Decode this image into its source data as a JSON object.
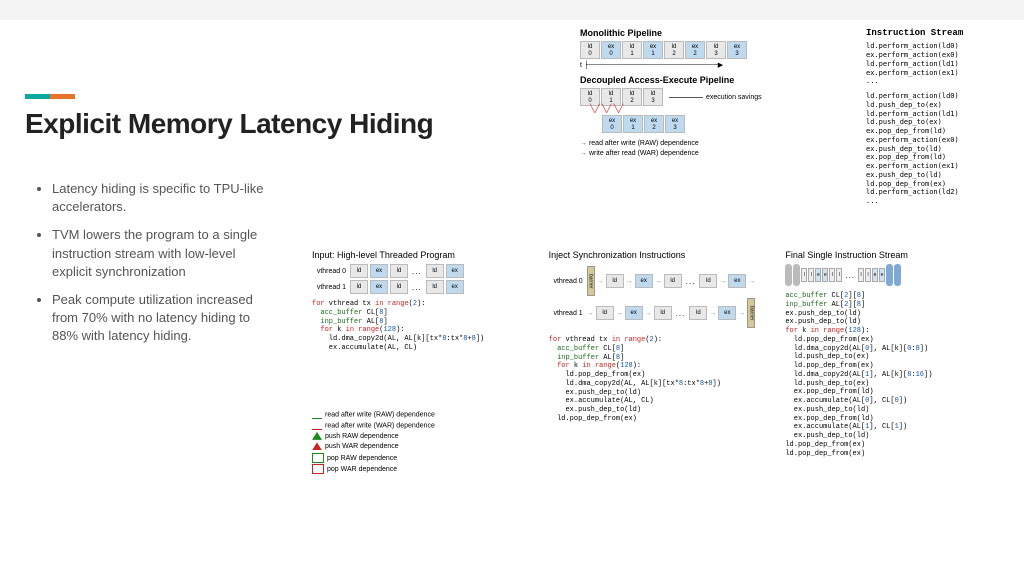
{
  "title": "Explicit Memory Latency Hiding",
  "bullets": [
    "Latency hiding is specific to TPU-like accelerators.",
    "TVM lowers the program to a single instruction stream with low-level explicit synchronization",
    "Peak compute utilization increased from 70% with no latency hiding to 88% with latency hiding."
  ],
  "top": {
    "mono_label": "Monolithic Pipeline",
    "dae_label": "Decoupled Access-Execute Pipeline",
    "instr_label": "Instruction Stream",
    "exec_savings": "execution savings",
    "t_axis": "t",
    "raw_dep": "read after write  (RAW) dependence",
    "war_dep": "write after read  (WAR) dependence",
    "mono_stages": [
      {
        "k": "ld",
        "n": "0"
      },
      {
        "k": "ex",
        "n": "0"
      },
      {
        "k": "ld",
        "n": "1"
      },
      {
        "k": "ex",
        "n": "1"
      },
      {
        "k": "ld",
        "n": "2"
      },
      {
        "k": "ex",
        "n": "2"
      },
      {
        "k": "ld",
        "n": "3"
      },
      {
        "k": "ex",
        "n": "3"
      }
    ],
    "dae_ld": [
      {
        "k": "ld",
        "n": "0"
      },
      {
        "k": "ld",
        "n": "1"
      },
      {
        "k": "ld",
        "n": "2"
      },
      {
        "k": "ld",
        "n": "3"
      }
    ],
    "dae_ex": [
      {
        "k": "ex",
        "n": "0"
      },
      {
        "k": "ex",
        "n": "1"
      },
      {
        "k": "ex",
        "n": "2"
      },
      {
        "k": "ex",
        "n": "3"
      }
    ],
    "instr1": "ld.perform_action(ld0)\nex.perform_action(ex0)\nld.perform_action(ld1)\nex.perform_action(ex1)\n...",
    "instr2": "ld.perform_action(ld0)\nld.push_dep_to(ex)\nld.perform_action(ld1)\nld.push_dep_to(ex)\nex.pop_dep_from(ld)\nex.perform_action(ex0)\nex.push_dep_to(ld)\nex.pop_dep_from(ld)\nex.perform_action(ex1)\nex.push_dep_to(ld)\nld.pop_dep_from(ex)\nld.perform_action(ld2)\n..."
  },
  "panels": {
    "p1_title": "Input: High-level Threaded Program",
    "p2_title": "Inject Synchronization Instructions",
    "p3_title": "Final Single Instruction Stream",
    "vth0": "vthread 0",
    "vth1": "vthread 1",
    "barrier": "barrier"
  },
  "code": {
    "p1": "for vthread tx in range(2):\n  acc_buffer CL[8]\n  inp_buffer AL[8]\n  for k in range(128):\n    ld.dma_copy2d(AL, AL[k][tx*8:tx*8+8])\n    ex.accumulate(AL, CL)",
    "p2": "for vthread tx in range(2):\n  acc_buffer CL[8]\n  inp_buffer AL[8]\n  for k in range(128):\n    ld.pop_dep_from(ex)\n    ld.dma_copy2d(AL, AL[k][tx*8:tx*8+8])\n    ex.push_dep_to(ld)\n    ex.accumulate(AL, CL)\n    ex.push_dep_to(ld)\n  ld.pop_dep_from(ex)",
    "p3": "acc_buffer CL[2][8]\ninp_buffer AL[2][8]\nex.push_dep_to(ld)\nex.push_dep_to(ld)\nfor k in range(128):\n  ld.pop_dep_from(ex)\n  ld.dma_copy2d(AL[0], AL[k][0:8])\n  ld.push_dep_to(ex)\n  ld.pop_dep_from(ex)\n  ld.dma_copy2d(AL[1], AL[k][8:16])\n  ld.push_dep_to(ex)\n  ex.pop_dep_from(ld)\n  ex.accumulate(AL[0], CL[0])\n  ex.push_dep_to(ld)\n  ex.pop_dep_from(ld)\n  ex.accumulate(AL[1], CL[1])\n  ex.push_dep_to(ld)\nld.pop_dep_from(ex)\nld.pop_dep_from(ex)"
  },
  "legend2": {
    "raw": "read after write  (RAW) dependence",
    "war": "read after write  (WAR) dependence",
    "push_raw": "push RAW dependence",
    "push_war": "push WAR dependence",
    "pop_raw": "pop RAW dependence",
    "pop_war": "pop WAR dependence"
  }
}
